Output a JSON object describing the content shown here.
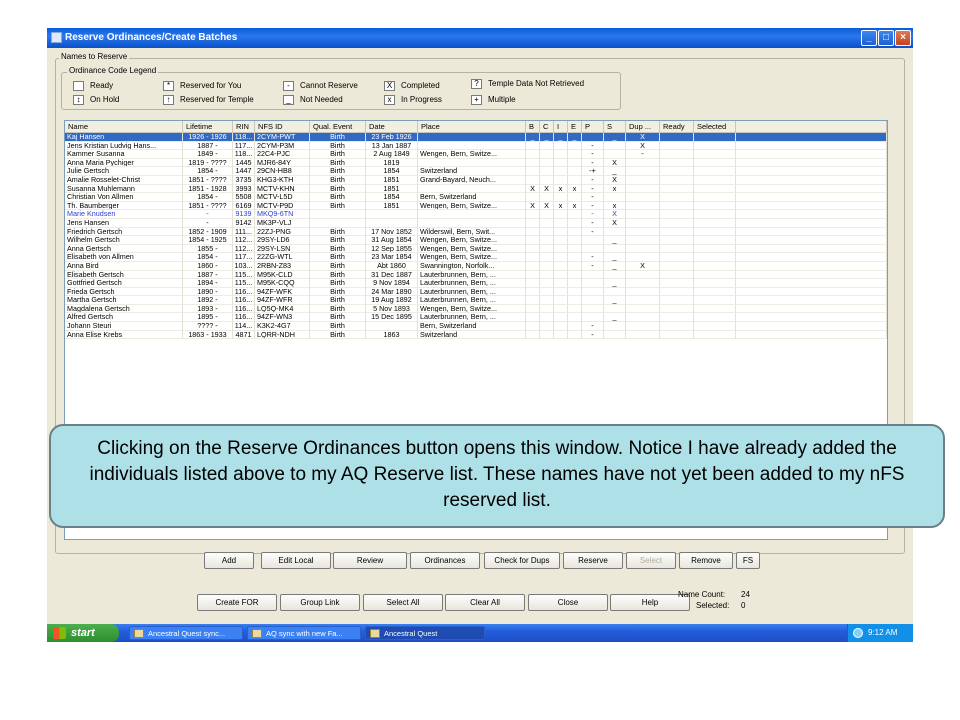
{
  "window": {
    "title": "Reserve Ordinances/Create Batches"
  },
  "groups": {
    "names_to_reserve": "Names to Reserve",
    "legend": "Ordinance Code Legend"
  },
  "legend": [
    {
      "symbol": "",
      "label": "Ready"
    },
    {
      "symbol": "*",
      "label": "Reserved for You"
    },
    {
      "symbol": "-",
      "label": "Cannot Reserve"
    },
    {
      "symbol": "X",
      "label": "Completed"
    },
    {
      "symbol": "?",
      "label": "Temple Data Not Retrieved"
    },
    {
      "symbol": "↕",
      "label": "On Hold"
    },
    {
      "symbol": "↑",
      "label": "Reserved for Temple"
    },
    {
      "symbol": "_",
      "label": "Not Needed"
    },
    {
      "symbol": "x",
      "label": "In Progress"
    },
    {
      "symbol": "+",
      "label": "Multiple"
    }
  ],
  "columns": [
    "Name",
    "Lifetime",
    "RIN",
    "NFS ID",
    "Qual. Event",
    "Date",
    "Place",
    "B",
    "C",
    "I",
    "E",
    "P",
    "S",
    "Dup ...",
    "Ready",
    "Selected"
  ],
  "rows": [
    [
      "Kaj Hansen",
      "1926 - 1926",
      "118...",
      "2CYM-PWT",
      "Birth",
      "23 Feb 1926",
      "",
      "_",
      "_",
      "_",
      "_",
      "",
      "_",
      "X",
      "",
      ""
    ],
    [
      "Jens Kristian Ludvig Hans...",
      "1887 -",
      "117...",
      "2CYM-P3M",
      "Birth",
      "13 Jan 1887",
      "",
      "",
      "",
      "",
      "",
      "-",
      "",
      "X",
      "",
      ""
    ],
    [
      "Kammer Susanna",
      "1849 -",
      "118...",
      "22C4-PJC",
      "Birth",
      "2 Aug 1849",
      "Wengen, Bern, Switze...",
      "",
      "",
      "",
      "",
      "-",
      "",
      "-",
      "",
      ""
    ],
    [
      "Anna Maria Pychiger",
      "1819 - ????",
      "1445",
      "MJR6-84Y",
      "Birth",
      "1819",
      "",
      "",
      "",
      "",
      "",
      "-",
      "X",
      "",
      "",
      ""
    ],
    [
      "Julie Gertsch",
      "1854 -",
      "1447",
      "29CN-HB8",
      "Birth",
      "1854",
      "Switzerland",
      "",
      "",
      "",
      "",
      "-+",
      "_",
      "",
      "",
      ""
    ],
    [
      "Amalie Rosselet-Christ",
      "1851 - ????",
      "3735",
      "KHG3-KTH",
      "Birth",
      "1851",
      "Grand-Bayard, Neuch...",
      "",
      "",
      "",
      "",
      "-",
      "X",
      "",
      "",
      ""
    ],
    [
      "Susanna Muhlemann",
      "1851 - 1928",
      "3993",
      "MCTV-KHN",
      "Birth",
      "1851",
      "",
      "X",
      "X",
      "x",
      "x",
      "-",
      "x",
      "",
      "",
      ""
    ],
    [
      "Christian Von Allmen",
      "1854 -",
      "5508",
      "MCTV-L5D",
      "Birth",
      "1854",
      "Bern, Switzerland",
      "",
      "",
      "",
      "",
      "-",
      "",
      "",
      "",
      ""
    ],
    [
      "Th. Baumberger",
      "1851 - ????",
      "6169",
      "MCTV-P9D",
      "Birth",
      "1851",
      "Wengen, Bern, Switze...",
      "X",
      "X",
      "x",
      "x",
      "-",
      "x",
      "",
      "",
      ""
    ],
    [
      "Marie Knudsen",
      "-",
      "9139",
      "MKQ9-6TN",
      "",
      "",
      "",
      "",
      "",
      "",
      "",
      "-",
      "X",
      "",
      "",
      ""
    ],
    [
      "Jens Hansen",
      "-",
      "9142",
      "MK3P-VLJ",
      "",
      "",
      "",
      "",
      "",
      "",
      "",
      "-",
      "X",
      "",
      "",
      ""
    ],
    [
      "Friedrich Gertsch",
      "1852 - 1909",
      "111...",
      "22ZJ-PNG",
      "Birth",
      "17 Nov 1852",
      "Wilderswil, Bern, Swit...",
      "",
      "",
      "",
      "",
      "-",
      "_",
      "",
      "",
      ""
    ],
    [
      "Wilhelm Gertsch",
      "1854 - 1925",
      "112...",
      "29SY-LD6",
      "Birth",
      "31 Aug 1854",
      "Wengen, Bern, Switze...",
      "",
      "",
      "",
      "",
      "",
      "_",
      "",
      "",
      ""
    ],
    [
      "Anna Gertsch",
      "1855 -",
      "112...",
      "29SY-LSN",
      "Birth",
      "12 Sep 1855",
      "Wengen, Bern, Switze...",
      "",
      "",
      "",
      "",
      "",
      "_",
      "",
      "",
      ""
    ],
    [
      "Elisabeth von Allmen",
      "1854 -",
      "117...",
      "22ZG-WTL",
      "Birth",
      "23 Mar 1854",
      "Wengen, Bern, Switze...",
      "",
      "",
      "",
      "",
      "-",
      "_",
      "",
      "",
      ""
    ],
    [
      "Anna Bird",
      "1860 -",
      "103...",
      "2RBN-Z83",
      "Birth",
      "Abt 1860",
      "Swannington, Norfolk...",
      "",
      "",
      "",
      "",
      "-",
      "_",
      "X",
      "",
      ""
    ],
    [
      "Elisabeth Gertsch",
      "1887 -",
      "115...",
      "M95K-CLD",
      "Birth",
      "31 Dec 1887",
      "Lauterbrunnen, Bern, ...",
      "",
      "",
      "",
      "",
      "",
      "_",
      "",
      "",
      ""
    ],
    [
      "Gottfried Gertsch",
      "1894 -",
      "115...",
      "M95K-CQQ",
      "Birth",
      "9 Nov 1894",
      "Lauterbrunnen, Bern, ...",
      "",
      "",
      "",
      "",
      "",
      "_",
      "",
      "",
      ""
    ],
    [
      "Frieda Gertsch",
      "1890 -",
      "116...",
      "94ZF-WFK",
      "Birth",
      "24 Mar 1890",
      "Lauterbrunnen, Bern, ...",
      "",
      "",
      "",
      "",
      "",
      "_",
      "",
      "",
      ""
    ],
    [
      "Martha Gertsch",
      "1892 -",
      "116...",
      "94ZF-WFR",
      "Birth",
      "19 Aug 1892",
      "Lauterbrunnen, Bern, ...",
      "",
      "",
      "",
      "",
      "",
      "_",
      "",
      "",
      ""
    ],
    [
      "Magdalena Gertsch",
      "1893 -",
      "116...",
      "LQ5Q-MK4",
      "Birth",
      "5 Nov 1893",
      "Wengen, Bern, Switze...",
      "",
      "",
      "",
      "",
      "",
      "_",
      "",
      "",
      ""
    ],
    [
      "Alfred Gertsch",
      "1895 -",
      "116...",
      "94ZF-WN3",
      "Birth",
      "15 Dec 1895",
      "Lauterbrunnen, Bern, ...",
      "",
      "",
      "",
      "",
      "",
      "_",
      "",
      "",
      ""
    ],
    [
      "Johann Steuri",
      "???? -",
      "114...",
      "K3K2-4G7",
      "Birth",
      "",
      "Bern, Switzerland",
      "",
      "",
      "",
      "",
      "-",
      "",
      "",
      "",
      ""
    ],
    [
      "Anna Elise Krebs",
      "1863 - 1933",
      "4871",
      "LQRR-NDH",
      "Birth",
      "1863",
      "Switzerland",
      "",
      "",
      "",
      "",
      "-",
      "",
      "",
      "",
      ""
    ]
  ],
  "action_buttons": [
    "Add",
    "Edit Local",
    "Review",
    "Ordinances",
    "Check for Dups",
    "Reserve",
    "Select",
    "Remove",
    "FS"
  ],
  "bottom_buttons": [
    "Create FOR",
    "Group Link",
    "Select All",
    "Clear All",
    "Close",
    "Help"
  ],
  "counts": {
    "name_count_label": "Name Count:",
    "name_count": "24",
    "selected_label": "Selected:",
    "selected": "0"
  },
  "taskbar": {
    "start": "start",
    "tasks": [
      "Ancestral Quest sync...",
      "AQ sync with new Fa...",
      "Ancestral Quest"
    ],
    "clock": "9:12 AM"
  },
  "callout": "Clicking on the Reserve Ordinances button opens this window.  Notice I have already added the individuals listed above to my AQ Reserve list.  These names have not yet been added to my nFS reserved list."
}
